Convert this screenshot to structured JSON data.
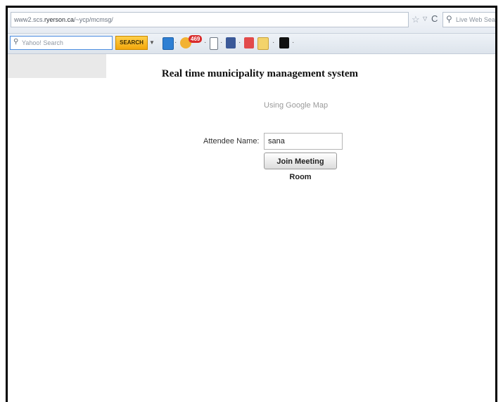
{
  "browser": {
    "url_prefix": "www2.scs.",
    "url_domain": "ryerson.ca",
    "url_path": "/~ycp/mcmsg/",
    "search_placeholder": "Live Web Search",
    "star_icon": "star-icon",
    "reload_icon": "reload-icon"
  },
  "toolbar": {
    "yahoo_search_placeholder": "Yahoo! Search",
    "search_button_label": "SEARCH",
    "notification_count": "469",
    "accent_color": "#f3a70c"
  },
  "page": {
    "title": "Real time municipality management system",
    "subtitle": "Using Google Map",
    "attendee_label": "Attendee Name:",
    "attendee_value": "sana",
    "join_button_label": "Join Meeting Room"
  }
}
